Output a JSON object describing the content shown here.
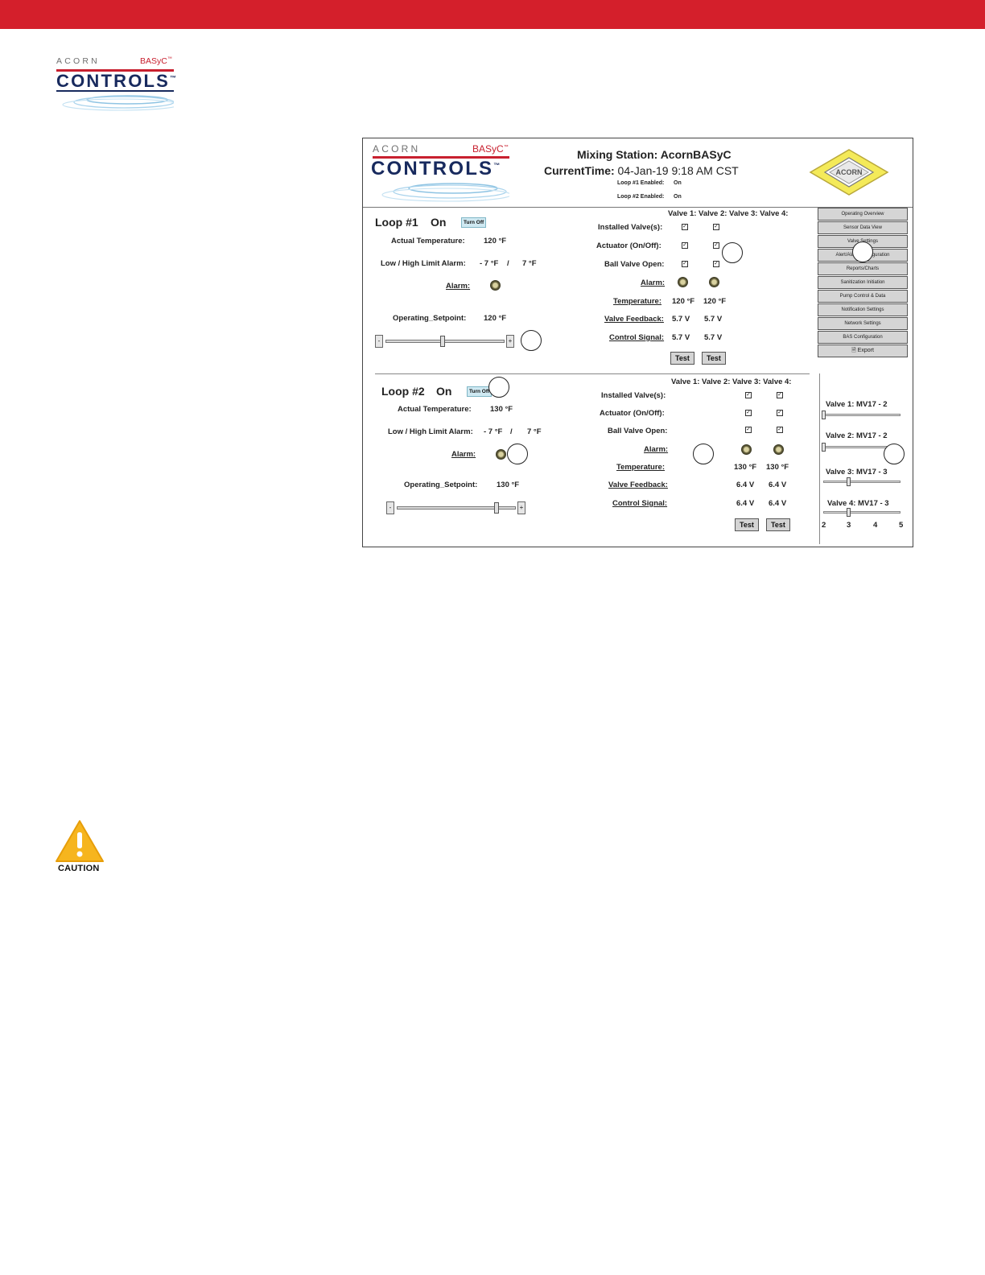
{
  "page": {
    "logo": {
      "acorn": "ACORN",
      "basyc": "BASyC",
      "tm": "™",
      "controls": "CONTROLS",
      "controls_tm": "™"
    },
    "caution_label": "CAUTION"
  },
  "screen": {
    "logo": {
      "acorn": "ACORN",
      "basyc": "BASyC",
      "tm": "™",
      "controls": "CONTROLS",
      "controls_tm": "™"
    },
    "emblem_text": "ACORN",
    "station_title": "Mixing Station: AcornBASyC",
    "current_time_label": "CurrentTime:",
    "current_time_value": "04-Jan-19 9:18 AM CST",
    "loop1_enabled_label": "Loop #1 Enabled:",
    "loop1_enabled_value": "On",
    "loop2_enabled_label": "Loop #2 Enabled:",
    "loop2_enabled_value": "On",
    "nav": [
      "Operating Overview",
      "Sensor Data View",
      "Valve Settings",
      "Alert/Alarm Configuration",
      "Reports/Charts",
      "Sanitization Initiation",
      "Pump Control & Data",
      "Notification Settings",
      "Network Settings",
      "BAS Configuration",
      "Export"
    ],
    "valve_header": "Valve 1: Valve 2: Valve 3: Valve 4:",
    "loop1": {
      "title": "Loop #1",
      "state": "On",
      "turn_off": "Turn Off",
      "actual_temp_label": "Actual Temperature:",
      "actual_temp_value": "120 °F",
      "limit_label": "Low / High Limit Alarm:",
      "limit_low": "- 7 °F",
      "limit_sep": "/",
      "limit_high": "7 °F",
      "alarm_label": "Alarm:",
      "setpoint_label": "Operating_Setpoint:",
      "setpoint_value": "120 °F",
      "slider_minus": "-",
      "slider_plus": "+",
      "setpoint_slider_fraction": 0.48,
      "rows": {
        "installed": "Installed Valve(s):",
        "actuator": "Actuator (On/Off):",
        "ball": "Ball Valve Open:",
        "alarm": "Alarm:",
        "temperature": "Temperature:",
        "feedback": "Valve Feedback:",
        "control": "Control Signal:"
      },
      "v1": {
        "temperature": "120 °F",
        "feedback": "5.7 V",
        "control": "5.7 V"
      },
      "v2": {
        "temperature": "120 °F",
        "feedback": "5.7 V",
        "control": "5.7 V"
      },
      "test": "Test"
    },
    "loop2": {
      "title": "Loop #2",
      "state": "On",
      "turn_off": "Turn Off",
      "actual_temp_label": "Actual Temperature:",
      "actual_temp_value": "130 °F",
      "limit_label": "Low / High Limit Alarm:",
      "limit_low": "- 7 °F",
      "limit_sep": "/",
      "limit_high": "7 °F",
      "alarm_label": "Alarm:",
      "setpoint_label": "Operating_Setpoint:",
      "setpoint_value": "130 °F",
      "slider_minus": "-",
      "slider_plus": "+",
      "setpoint_slider_fraction": 0.85,
      "rows": {
        "installed": "Installed Valve(s):",
        "actuator": "Actuator (On/Off):",
        "ball": "Ball Valve Open:",
        "alarm": "Alarm:",
        "temperature": "Temperature:",
        "feedback": "Valve Feedback:",
        "control": "Control Signal:"
      },
      "v1": {
        "temperature": "130 °F",
        "feedback": "6.4 V",
        "control": "6.4 V"
      },
      "v2": {
        "temperature": "130 °F",
        "feedback": "6.4 V",
        "control": "6.4 V"
      },
      "test": "Test"
    },
    "valve_sizes": [
      {
        "label": "Valve 1:",
        "model": "MV17 -",
        "size": "2"
      },
      {
        "label": "Valve 2:",
        "model": "MV17 -",
        "size": "2"
      },
      {
        "label": "Valve 3:",
        "model": "MV17 -",
        "size": "3"
      },
      {
        "label": "Valve 4:",
        "model": "MV17 -",
        "size": "3"
      }
    ],
    "size_scale": [
      "2",
      "3",
      "4",
      "5"
    ]
  }
}
